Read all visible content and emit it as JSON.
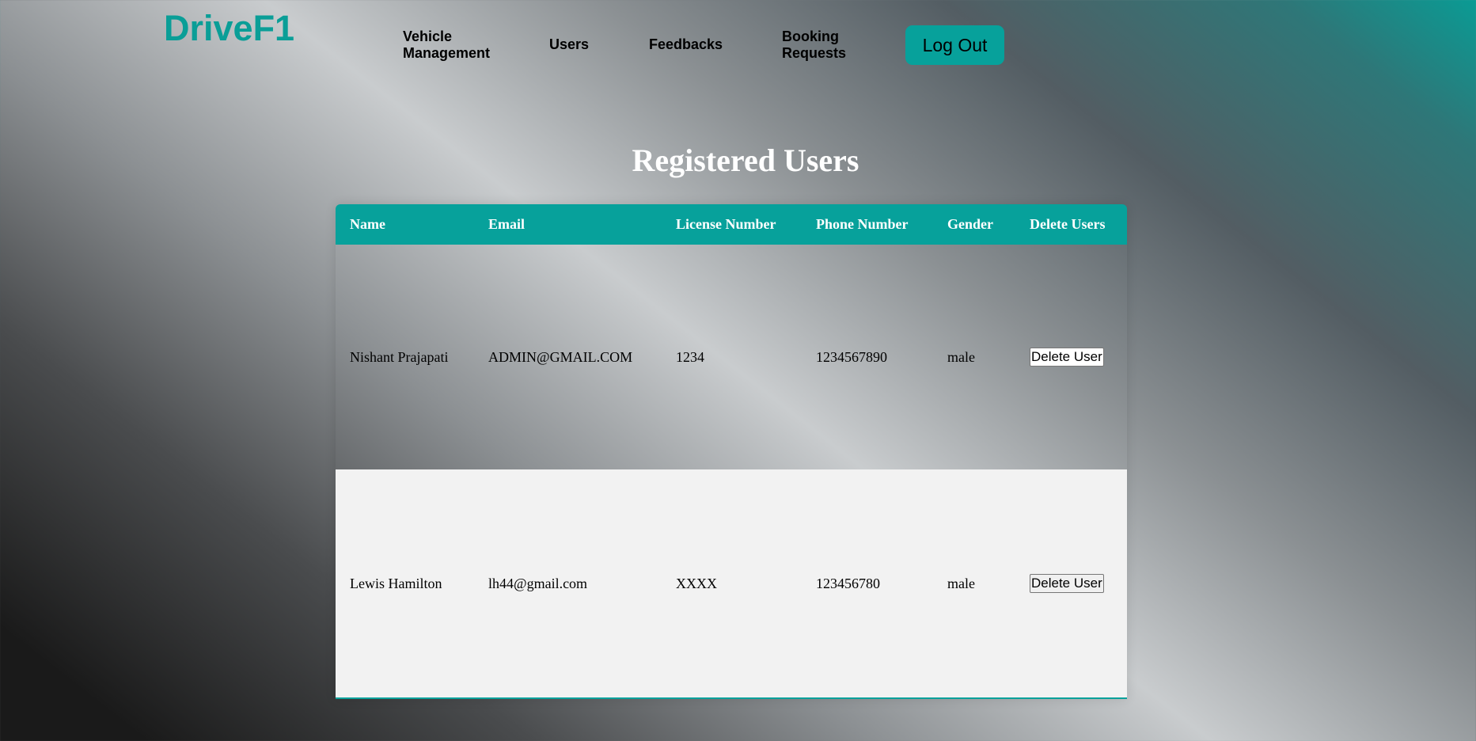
{
  "brand": {
    "logo_text": "DriveF1"
  },
  "nav": {
    "items": [
      {
        "label": "Vehicle\nManagement"
      },
      {
        "label": "Users"
      },
      {
        "label": "Feedbacks"
      },
      {
        "label": "Booking\nRequests"
      }
    ],
    "logout_label": "Log Out"
  },
  "page": {
    "title": "Registered Users"
  },
  "table": {
    "headers": [
      "Name",
      "Email",
      "License Number",
      "Phone Number",
      "Gender",
      "Delete Users"
    ],
    "rows": [
      {
        "name": "Nishant Prajapati",
        "email": "ADMIN@GMAIL.COM",
        "license": "1234",
        "phone": "1234567890",
        "gender": "male",
        "action": "Delete User"
      },
      {
        "name": "Lewis Hamilton",
        "email": "lh44@gmail.com",
        "license": "XXXX",
        "phone": "123456780",
        "gender": "male",
        "action": "Delete User"
      }
    ]
  },
  "colors": {
    "accent": "#07a19b",
    "logo": "#0a9e97",
    "title_text": "#ffffff",
    "row_alt_bg": "#f2f2f2"
  }
}
